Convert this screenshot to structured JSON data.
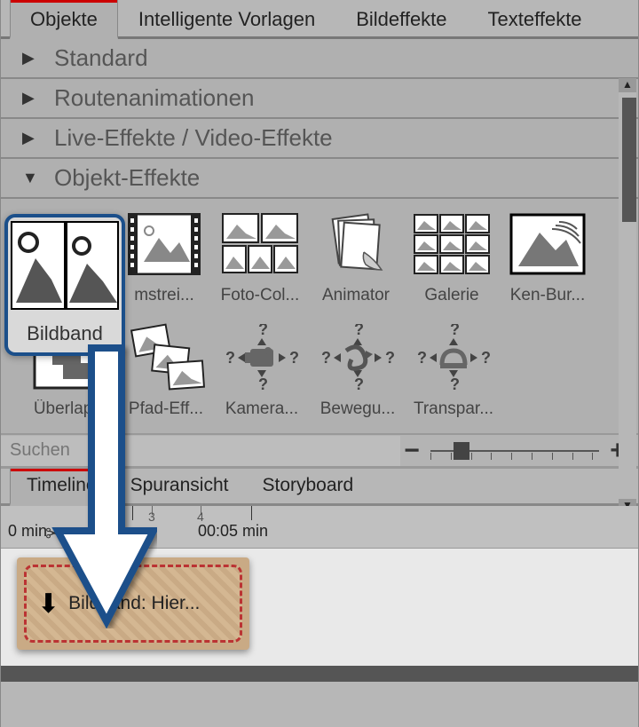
{
  "tabs_top": {
    "items": [
      "Objekte",
      "Intelligente Vorlagen",
      "Bildeffekte",
      "Texteffekte"
    ],
    "active": 0
  },
  "accordion": [
    {
      "label": "Standard",
      "open": false
    },
    {
      "label": "Routenanimationen",
      "open": false
    },
    {
      "label": "Live-Effekte / Video-Effekte",
      "open": false
    },
    {
      "label": "Objekt-Effekte",
      "open": true
    }
  ],
  "highlight": {
    "label": "Bildband"
  },
  "effects_row1": [
    {
      "short": "mstrei..."
    },
    {
      "short": "Foto-Col..."
    },
    {
      "short": "Animator"
    },
    {
      "short": "Galerie"
    },
    {
      "short": "Ken-Bur..."
    }
  ],
  "effects_row2": [
    {
      "short": "Überlap..."
    },
    {
      "short": "Pfad-Eff..."
    },
    {
      "short": "Kamera..."
    },
    {
      "short": "Bewegu..."
    },
    {
      "short": "Transpar..."
    }
  ],
  "search": {
    "placeholder": "Suchen"
  },
  "tabs_bottom": {
    "items": [
      "Timeline",
      "Spuransicht",
      "Storyboard"
    ],
    "active": 0
  },
  "ruler": {
    "label_left": "0 min",
    "label_right": "00:05 min",
    "tick3": "3",
    "tick4": "4"
  },
  "dropzone": {
    "label": "Bildband: Hier..."
  }
}
